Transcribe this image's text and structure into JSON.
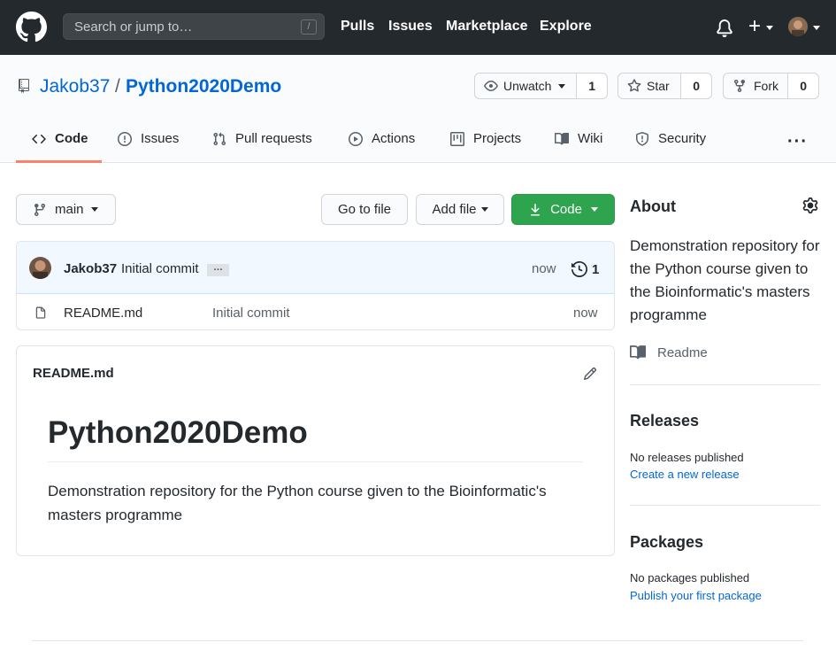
{
  "header": {
    "search_placeholder": "Search or jump to…",
    "search_key": "/",
    "nav": [
      "Pulls",
      "Issues",
      "Marketplace",
      "Explore"
    ],
    "plus_label": "+"
  },
  "repo": {
    "owner": "Jakob37",
    "separator": "/",
    "name": "Python2020Demo",
    "watch_label": "Unwatch",
    "watch_count": "1",
    "star_label": "Star",
    "star_count": "0",
    "fork_label": "Fork",
    "fork_count": "0"
  },
  "tabs": [
    {
      "label": "Code",
      "icon": "code-icon",
      "selected": true
    },
    {
      "label": "Issues",
      "icon": "issue-opened-icon"
    },
    {
      "label": "Pull requests",
      "icon": "git-pull-request-icon"
    },
    {
      "label": "Actions",
      "icon": "play-icon"
    },
    {
      "label": "Projects",
      "icon": "project-icon"
    },
    {
      "label": "Wiki",
      "icon": "book-icon"
    },
    {
      "label": "Security",
      "icon": "shield-icon"
    }
  ],
  "more_label": "···",
  "toolbar": {
    "branch": "main",
    "go_to_file": "Go to file",
    "add_file": "Add file",
    "code": "Code"
  },
  "commit": {
    "author": "Jakob37",
    "message": "Initial commit",
    "ellipsis": "…",
    "time": "now",
    "count": "1"
  },
  "files": [
    {
      "name": "README.md",
      "commit": "Initial commit",
      "time": "now"
    }
  ],
  "readme": {
    "label": "README.md",
    "title": "Python2020Demo",
    "body": "Demonstration repository for the Python course given to the Bioinformatic's masters programme"
  },
  "sidebar": {
    "about_title": "About",
    "description": "Demonstration repository for the Python course given to the Bioinformatic's masters programme",
    "readme_link": "Readme",
    "releases_title": "Releases",
    "releases_none": "No releases published",
    "releases_link": "Create a new release",
    "packages_title": "Packages",
    "packages_none": "No packages published",
    "packages_link": "Publish your first package"
  },
  "colors": {
    "header_bg": "#24292e",
    "link": "#0366d6",
    "green_button": "#2ea44f",
    "tab_underline": "#f9826c",
    "commit_bar": "#f1f8ff"
  }
}
